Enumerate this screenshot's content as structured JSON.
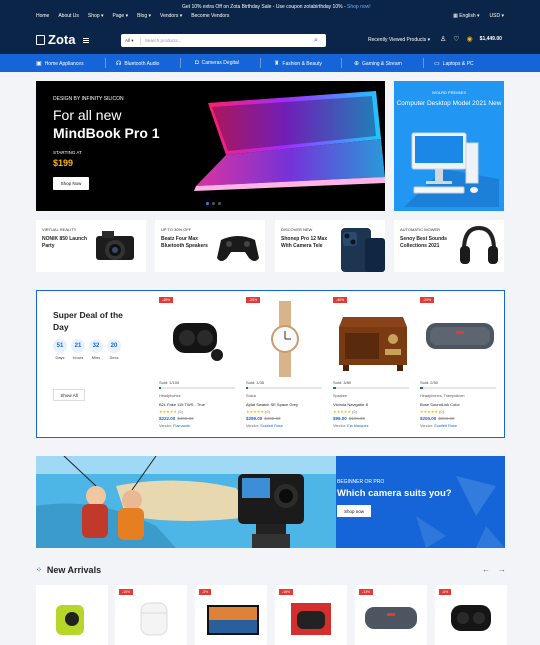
{
  "topbar": {
    "nav": [
      "Home",
      "About Us",
      "Shop",
      "Page",
      "Blog",
      "Vendors",
      "Become Vendors"
    ],
    "promo_text": "Get 10% extra Off on Zota Birthday Sale - Use coupon zotabirthday 10% -",
    "promo_link": "Shop now!",
    "language": "English",
    "currency": "USD"
  },
  "header": {
    "logo": "Zota",
    "search_category": "All",
    "search_placeholder": "Search products...",
    "recent": "Recently Viewed Products",
    "cart_total": "$1,449.00"
  },
  "categories": [
    "Home Appliances",
    "Bluetooth Audio",
    "Cameras Degital",
    "Fashion & Beauty",
    "Gaming & Stream",
    "Laptops & PC"
  ],
  "hero": {
    "tagline": "DESIGN BY INFINITY SILICON",
    "title_1": "For all new",
    "title_2": "MindBook Pro 1",
    "starting": "STARTING AT",
    "price": "$199",
    "button": "Shop Now"
  },
  "side_banner": {
    "kicker": "WOLRD PREMIES",
    "title": "Computer Desktop Model 2021 New"
  },
  "mini_banners": [
    {
      "kicker": "VIRTUAL REALITY",
      "title": "NONIK 850 Launch Party"
    },
    {
      "kicker": "UP TO 30% OFF",
      "title": "Beatz Four Max Bluetooth Speakers"
    },
    {
      "kicker": "DISCOVER NEW",
      "title": "Shonep Pro 12 Max With Camera Tele"
    },
    {
      "kicker": "AUTOMATIC MOWER",
      "title": "Senoy Best Sounds Collections 2021"
    }
  ],
  "deal": {
    "title": "Super Deal of the Day",
    "countdown": [
      {
        "value": "51",
        "label": "Days"
      },
      {
        "value": "21",
        "label": "Hours"
      },
      {
        "value": "32",
        "label": "Mins"
      },
      {
        "value": "20",
        "label": "Secs"
      }
    ],
    "show_all": "Show All",
    "products": [
      {
        "badge": "-45%",
        "sold": "Sold: 1/100",
        "progress": 0.01,
        "vendor": "Headphones",
        "name": "B2L Fake 115 TWS - True",
        "rating": "(0)",
        "price": "$222.00",
        "old_price": "$400.00",
        "vendor_label": "Vendor:",
        "vendor_name": "Flamands"
      },
      {
        "badge": "-25%",
        "sold": "Sold: 1/35",
        "progress": 0.03,
        "vendor": "Sokra",
        "name": "Aplat Swatch SE Space Grey",
        "rating": "(0)",
        "price": "$299.00",
        "old_price": "$400.00",
        "vendor_label": "Vendor:",
        "vendor_name": "Scarlett Rose"
      },
      {
        "badge": "-40%",
        "sold": "Sold: 3/80",
        "progress": 0.04,
        "vendor": "Sparkee",
        "name": "Victrola Navigator 8",
        "rating": "(0)",
        "price": "$99.00",
        "old_price": "$165.00",
        "vendor_label": "Vendor:",
        "vendor_name": "Ela Marquez"
      },
      {
        "badge": "-20%",
        "sold": "Sold: 2/50",
        "progress": 0.04,
        "vendor": "Headphones, Trampolinen",
        "name": "Bose SoundLink Color",
        "rating": "(0)",
        "price": "$200.00",
        "old_price": "$250.00",
        "vendor_label": "Vendor:",
        "vendor_name": "Scarlett Rose"
      }
    ]
  },
  "camera_banner": {
    "kicker": "BEGINNER OR PRO",
    "title": "Which camera suits you?",
    "button": "Shop now"
  },
  "new_arrivals": {
    "title": "New Arrivals",
    "badges": [
      "-10%",
      "-3%",
      "-16%",
      "-13%",
      "-6%"
    ]
  },
  "colors": {
    "navy": "#0b2548",
    "blue": "#1565d8",
    "red": "#e53935",
    "orange": "#ffb300"
  }
}
